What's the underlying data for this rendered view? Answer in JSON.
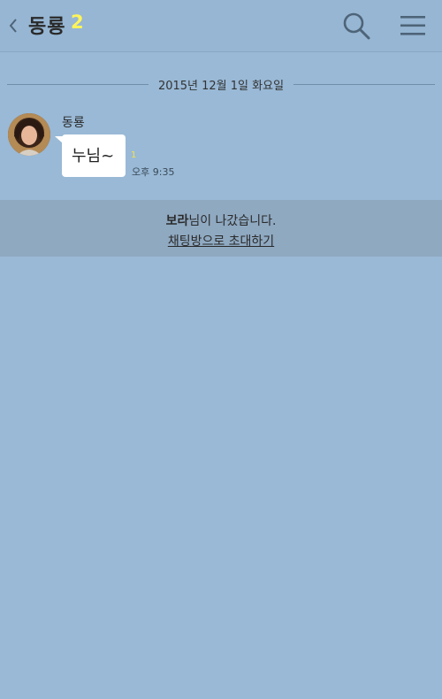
{
  "header": {
    "title": "동룡",
    "member_count": "2"
  },
  "date_divider": {
    "text": "2015년 12월 1일 화요일"
  },
  "message": {
    "sender": "동룡",
    "text": "누님~",
    "unread": "1",
    "time": "오후 9:35"
  },
  "system": {
    "left_user": "보라",
    "left_suffix": "님이 나갔습니다.",
    "invite_label": "채팅방으로 초대하기"
  },
  "colors": {
    "background": "#99b9d6",
    "member_count": "#fff45a",
    "unread": "#f2e34a",
    "bubble": "#ffffff"
  },
  "icons": {
    "back": "chevron-left-icon",
    "search": "search-icon",
    "menu": "hamburger-menu-icon"
  }
}
